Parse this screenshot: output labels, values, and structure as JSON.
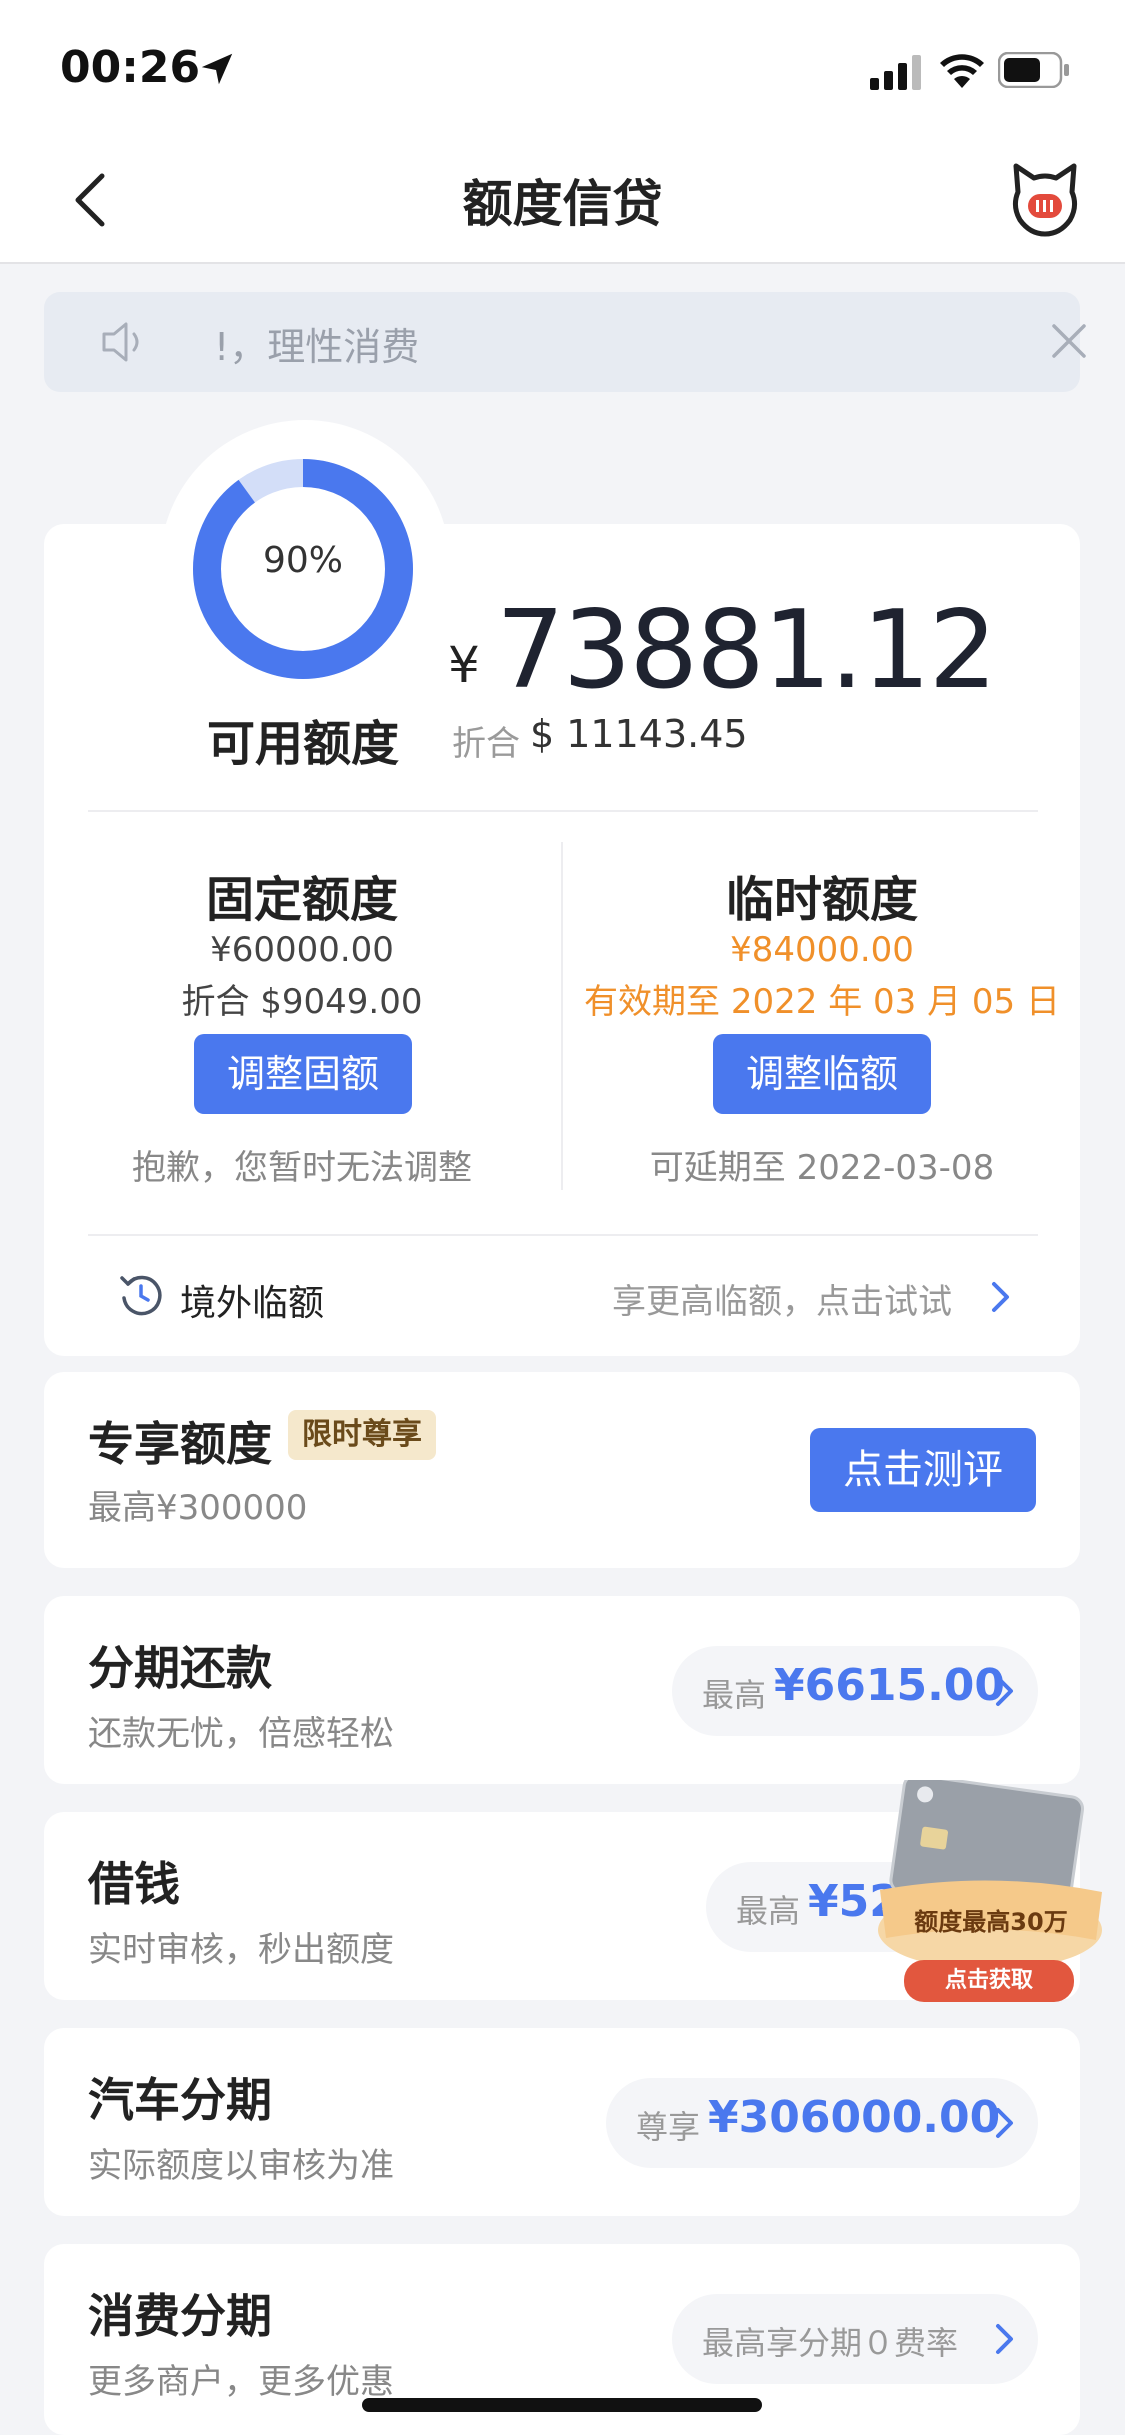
{
  "status_bar": {
    "time": "00:26"
  },
  "nav": {
    "title": "额度信贷"
  },
  "notice": {
    "text": "!，理性消费"
  },
  "credit": {
    "percent_label": "90%",
    "percent_value": 0.9,
    "available_label": "可用额度",
    "currency_symbol": "¥",
    "available_amount": "73881.12",
    "converted_label": "折合",
    "converted_amount": "$ 11143.45"
  },
  "fixed": {
    "title": "固定额度",
    "amount": "¥60000.00",
    "converted": "折合 $9049.00",
    "button": "调整固额",
    "note": "抱歉，您暂时无法调整"
  },
  "temp": {
    "title": "临时额度",
    "amount": "¥84000.00",
    "valid_until": "有效期至 2022 年 03 月 05 日",
    "button": "调整临额",
    "note": "可延期至 2022-03-08"
  },
  "overseas": {
    "label": "境外临额",
    "hint": "享更高临额，点击试试"
  },
  "exclusive": {
    "title": "专享额度",
    "tag": "限时尊享",
    "sub": "最高¥300000",
    "button": "点击测评"
  },
  "installment": {
    "title": "分期还款",
    "sub": "还款无忧，倍感轻松",
    "pill_label": "最高",
    "pill_value": "¥6615.00"
  },
  "borrow": {
    "title": "借钱",
    "sub": "实时审核，秒出额度",
    "pill_label": "最高",
    "pill_value": "¥52"
  },
  "car": {
    "title": "汽车分期",
    "sub": "实际额度以审核为准",
    "pill_label": "尊享",
    "pill_value": "¥306000.00"
  },
  "consume": {
    "title": "消费分期",
    "sub": "更多商户，更多优惠",
    "pill_label": "最高享分期０费率"
  },
  "promo": {
    "text": "额度最高30万",
    "button": "点击获取"
  },
  "colors": {
    "accent": "#4a78ee",
    "warning": "#f0902a",
    "card_bg": "#ffffff",
    "page_bg": "#f3f4f7"
  }
}
